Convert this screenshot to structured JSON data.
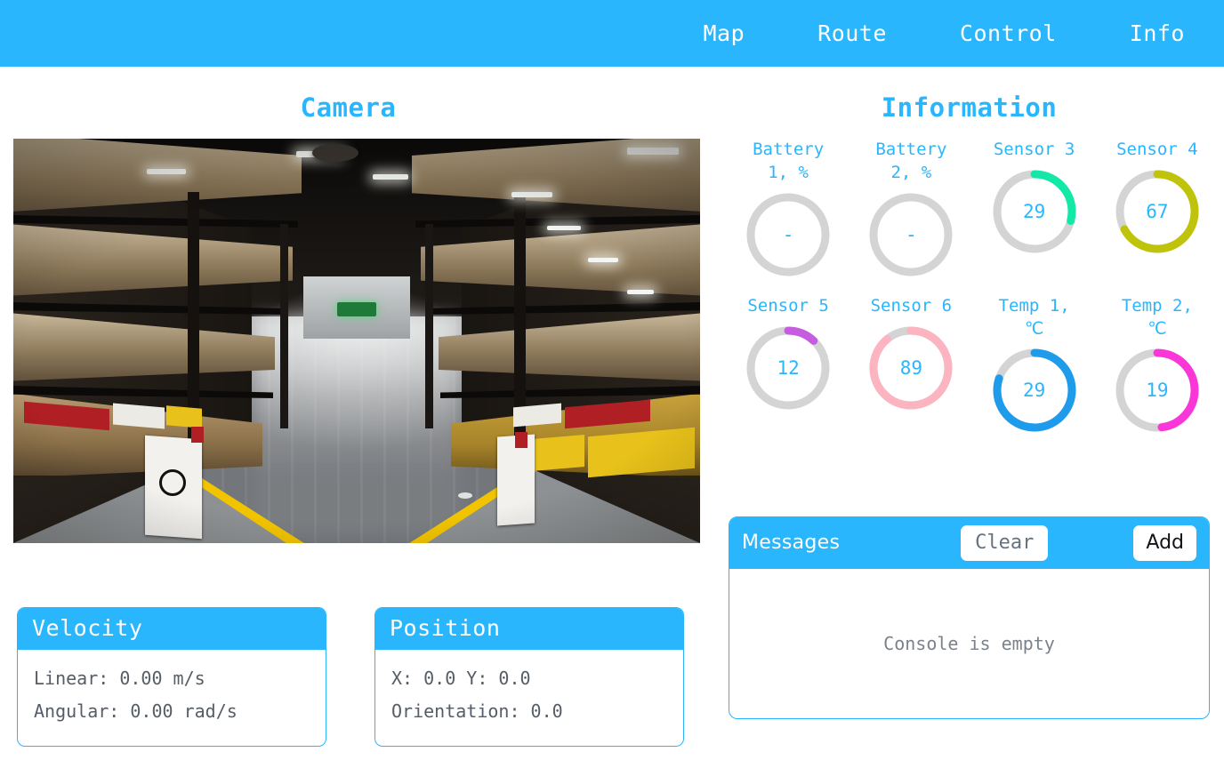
{
  "nav": {
    "items": [
      {
        "label": "Map"
      },
      {
        "label": "Route"
      },
      {
        "label": "Control"
      },
      {
        "label": "Info"
      }
    ]
  },
  "camera": {
    "title": "Camera",
    "scene_description": "Warehouse aisle with tall pallet racking, cardboard boxes, yellow floor guide lines and ceiling lights"
  },
  "information": {
    "title": "Information",
    "gauges": [
      {
        "label": "Battery 1, %",
        "value": "-",
        "percent": 0,
        "color": "#d4d4d4",
        "track": "#d4d4d4"
      },
      {
        "label": "Battery 2, %",
        "value": "-",
        "percent": 0,
        "color": "#d4d4d4",
        "track": "#d4d4d4"
      },
      {
        "label": "Sensor 3",
        "value": "29",
        "percent": 29,
        "color": "#13e8a7",
        "track": "#d4d4d4"
      },
      {
        "label": "Sensor 4",
        "value": "67",
        "percent": 67,
        "color": "#bfc40a",
        "track": "#d4d4d4"
      },
      {
        "label": "Sensor 5",
        "value": "12",
        "percent": 12,
        "color": "#c65ce0",
        "track": "#d4d4d4"
      },
      {
        "label": "Sensor 6",
        "value": "89",
        "percent": 89,
        "color": "#fcb4c0",
        "track": "#d4d4d4"
      },
      {
        "label": "Temp 1, ℃",
        "value": "29",
        "percent": 80,
        "color": "#1f9bec",
        "track": "#d4d4d4"
      },
      {
        "label": "Temp 2, ℃",
        "value": "19",
        "percent": 48,
        "color": "#fb36d8",
        "track": "#d4d4d4"
      }
    ]
  },
  "velocity": {
    "title": "Velocity",
    "linear": "Linear: 0.00 m/s",
    "angular": "Angular: 0.00 rad/s"
  },
  "position": {
    "title": "Position",
    "coords": "X: 0.0 Y: 0.0",
    "orientation": "Orientation: 0.0"
  },
  "messages": {
    "title": "Messages",
    "clear_label": "Clear",
    "add_label": "Add",
    "empty_text": "Console is empty"
  },
  "colors": {
    "accent": "#29b6fd",
    "track": "#d4d4d4",
    "text_muted": "#7b828a"
  }
}
